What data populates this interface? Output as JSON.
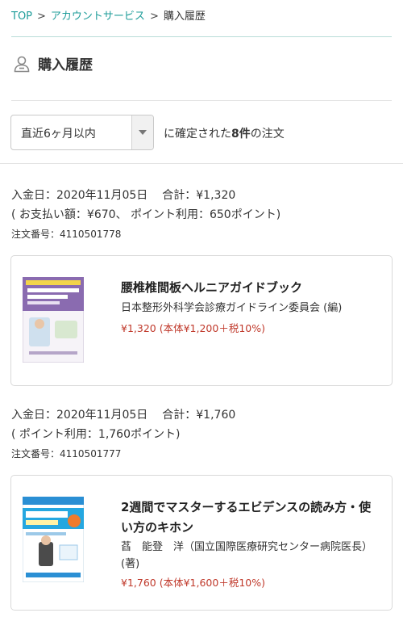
{
  "breadcrumb": {
    "top": "TOP",
    "sep1": ">",
    "account": "アカウントサービス",
    "sep2": ">",
    "current": "購入履歴"
  },
  "page_title": "購入履歴",
  "filter": {
    "selected": "直近6ヶ月以内",
    "text_before": "に確定された",
    "count": "8件",
    "text_after": "の注文"
  },
  "orders": [
    {
      "paid_label": "入金日：",
      "paid_date": "2020年11月05日",
      "total_label": "合計：",
      "total": "¥1,320",
      "breakdown": "( お支払い額：¥670、 ポイント利用：650ポイント)",
      "number_label": "注文番号：",
      "number": "4110501778",
      "book": {
        "title": "腰椎椎間板ヘルニアガイドブック",
        "author": "日本整形外科学会診療ガイドライン委員会 (編)",
        "price": "¥1,320 (本体¥1,200＋税10%)",
        "cover_text": "腰椎椎間板ヘルニアガイドブック"
      }
    },
    {
      "paid_label": "入金日：",
      "paid_date": "2020年11月05日",
      "total_label": "合計：",
      "total": "¥1,760",
      "breakdown": "( ポイント利用：1,760ポイント)",
      "number_label": "注文番号：",
      "number": "4110501777",
      "book": {
        "title": "2週間でマスターするエビデンスの読み方・使い方のキホン",
        "author": "萏　能登　洋（国立国際医療研究センター病院医長）(著)",
        "price": "¥1,760 (本体¥1,600＋税10%)",
        "cover_text": "エビデンスの読み方・使い方のキホン"
      }
    }
  ],
  "colors": {
    "link": "#1f9d9a",
    "price": "#c0392b",
    "divider_teal": "#b8dcd8"
  }
}
